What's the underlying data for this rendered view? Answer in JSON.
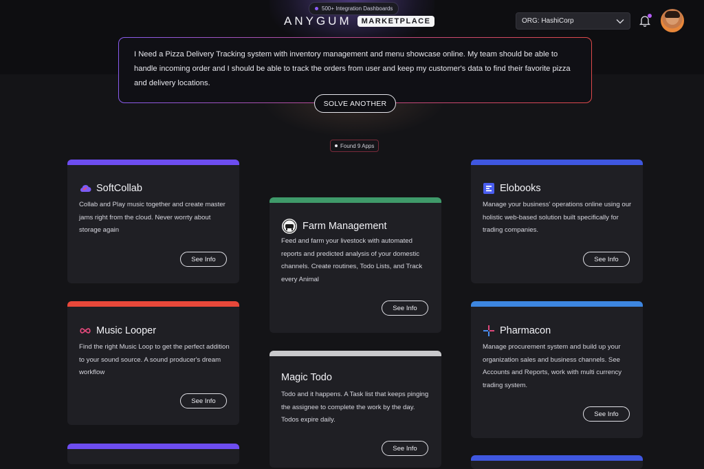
{
  "header": {
    "integrations_pill": "500+ Integration Dashboards",
    "brand_name": "ANYGUM",
    "brand_tag": "MARKETPLACE",
    "org_select": "ORG: HashiCorp"
  },
  "prompt": {
    "text": "I Need a Pizza Delivery Tracking system with inventory management and menu showcase online. My team should be able to handle incoming order and I should be able to track the orders from user and keep my customer's data to find their favorite pizza and delivery locations.",
    "solve_button": "SOLVE ANOTHER"
  },
  "results": {
    "found_label": "Found 9 Apps"
  },
  "cards": [
    {
      "title": "SoftCollab",
      "desc": "Collab and Play music together and create master jams right from the cloud. Never worrty about storage again",
      "button": "See Info",
      "accent": "#6d4df0",
      "icon": "cloud-icon"
    },
    {
      "title": "Music Looper",
      "desc": "Find the right Music Loop to get the perfect addition to your sound source. A sound producer's dream workflow",
      "button": "See Info",
      "accent": "#e8483a",
      "icon": "infinity-icon"
    },
    {
      "title": "Farm Management",
      "desc": "Feed and farm your livestock with automated reports and predicted analysis of your domestic channels. Create routines, Todo Lists, and Track every Animal",
      "button": "See Info",
      "accent": "#3f9a6a",
      "icon": "farm-logo-icon"
    },
    {
      "title": "Magic Todo",
      "desc": "Todo and it happens. A Task list that keeps pinging the assignee to complete the work by the day. Todos expire daily.",
      "button": "See Info",
      "accent": "#c9c9cc",
      "icon": ""
    },
    {
      "title": "Elobooks",
      "desc": "Manage your business' operations online using our holistic web-based solution built specifically for trading companies.",
      "button": "See Info",
      "accent": "#3f57e0",
      "icon": "book-icon"
    },
    {
      "title": "Pharmacon",
      "desc": "Manage procurement system and build up your organization sales and business channels. See Accounts and Reports, work with multi currency trading system.",
      "button": "See Info",
      "accent": "#3d86e0",
      "icon": "plus-cross-icon"
    },
    {
      "title": "",
      "desc": "",
      "button": "",
      "accent": "#6d4df0",
      "icon": ""
    },
    {
      "title": "",
      "desc": "",
      "button": "",
      "accent": "#3f57e0",
      "icon": ""
    }
  ]
}
